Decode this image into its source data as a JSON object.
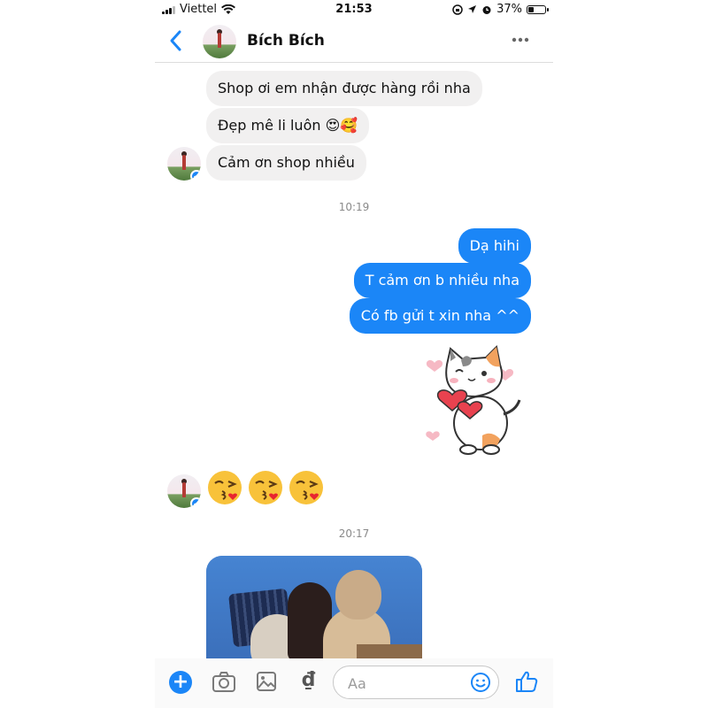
{
  "status_bar": {
    "carrier": "Viettel",
    "time": "21:53",
    "battery": "37%",
    "battery_level": 0.37
  },
  "header": {
    "contact_name": "Bích Bích"
  },
  "messages": {
    "in1": "Shop ơi em nhận được hàng rồi nha",
    "in2": "Đẹp mê li luôn 😍🥰",
    "in3": "Cảm ơn shop nhiều",
    "time1": "10:19",
    "out1": "Dạ hihi",
    "out2": "T cảm ơn b nhiều nha",
    "out3": "Có fb gửi t xin nha ^^",
    "time2": "20:17"
  },
  "composer": {
    "placeholder": "Aa",
    "currency_symbol": "₫"
  },
  "icons": [
    "back-arrow-icon",
    "more-icon",
    "wifi-icon",
    "alarm-icon",
    "location-icon",
    "camera-icon",
    "gallery-icon",
    "emoji-icon",
    "like-icon",
    "plus-icon"
  ],
  "colors": {
    "accent": "#1b86f7",
    "incoming_bubble": "#f1f0f0"
  }
}
